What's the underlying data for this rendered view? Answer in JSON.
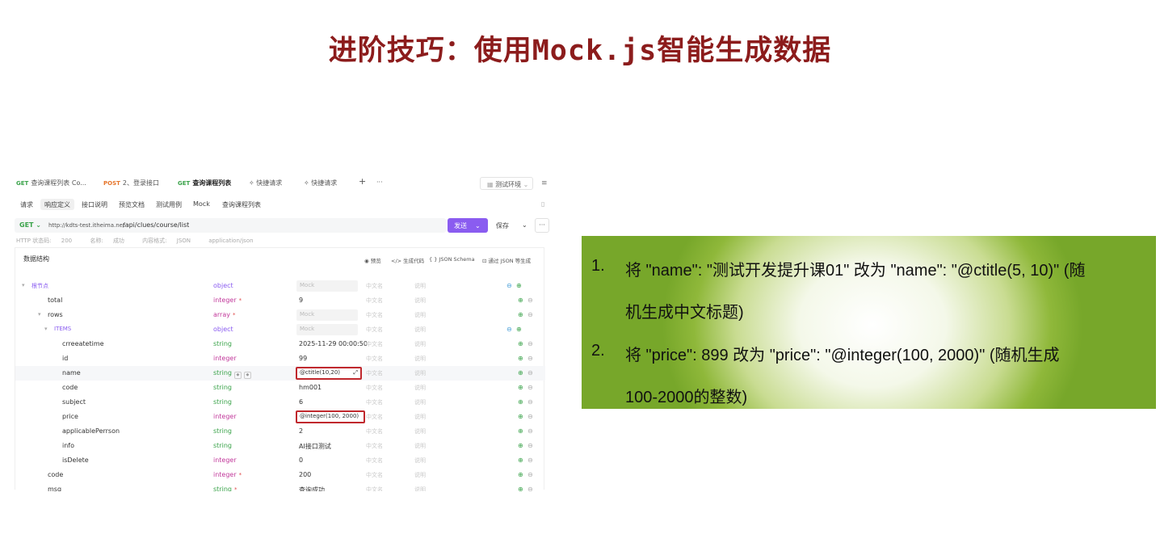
{
  "slide_title": "进阶技巧：使用Mock.js智能生成数据",
  "tabs": [
    {
      "method": "GET",
      "label": "查询课程列表 Co..."
    },
    {
      "method": "POST",
      "label": "2、登录接口"
    },
    {
      "method": "GET",
      "label": "查询课程列表"
    },
    {
      "method": "",
      "label": "快捷请求"
    },
    {
      "method": "",
      "label": "快捷请求"
    }
  ],
  "tab_add": "+",
  "tab_more": "···",
  "environment": "测试环境",
  "menu_icon": "≡",
  "sub_tabs": [
    "请求",
    "响应定义",
    "接口说明",
    "预览文档",
    "测试用例",
    "Mock",
    "查询课程列表"
  ],
  "sub_right_icon": "▯",
  "url": {
    "method": "GET",
    "base": "http://kdts-test.itheima.net",
    "path": "/api/clues/course/list",
    "send": "发送",
    "save": "保存",
    "chevron": "⌄",
    "more": "···"
  },
  "status": {
    "http_label": "HTTP 状态码:",
    "http_value": "200",
    "name_label": "名称:",
    "name_value": "成功",
    "format_label": "内容格式:",
    "format_value": "JSON",
    "content_type": "application/json"
  },
  "panel": {
    "title": "数据结构",
    "tools": [
      "◉ 预览",
      "</> 生成代码",
      "{ } JSON Schema",
      "⊡ 通过 JSON 等生成"
    ]
  },
  "schema_rows": [
    {
      "field": "根节点",
      "type": "object",
      "mock": "",
      "mock_ph": "Mock",
      "level": 0,
      "kind": "root",
      "expand": "▾",
      "req": false,
      "chips": false,
      "actions": [
        "⊖",
        "⊕"
      ],
      "box": false,
      "hl": false
    },
    {
      "field": "total",
      "type": "integer",
      "mock": "9",
      "mock_ph": "",
      "level": 1,
      "kind": "",
      "expand": "",
      "req": true,
      "chips": false,
      "actions": [
        "⊕",
        "⊖"
      ],
      "box": false,
      "hl": false
    },
    {
      "field": "rows",
      "type": "array",
      "mock": "",
      "mock_ph": "Mock",
      "level": 1,
      "kind": "",
      "expand": "▾",
      "req": true,
      "chips": false,
      "actions": [
        "⊕",
        "⊖"
      ],
      "box": false,
      "hl": false
    },
    {
      "field": "ITEMS",
      "type": "object",
      "mock": "",
      "mock_ph": "Mock",
      "level": 2,
      "kind": "items",
      "expand": "▾",
      "req": false,
      "chips": false,
      "actions": [
        "⊖",
        "⊕"
      ],
      "box": false,
      "hl": false
    },
    {
      "field": "crreeatetime",
      "type": "string",
      "mock": "2025-11-29 00:00:50",
      "mock_ph": "",
      "level": 3,
      "kind": "",
      "expand": "",
      "req": false,
      "chips": false,
      "actions": [
        "⊕",
        "⊖"
      ],
      "box": false,
      "hl": false
    },
    {
      "field": "id",
      "type": "integer",
      "mock": "99",
      "mock_ph": "",
      "level": 3,
      "kind": "",
      "expand": "",
      "req": false,
      "chips": false,
      "actions": [
        "⊕",
        "⊖"
      ],
      "box": false,
      "hl": false
    },
    {
      "field": "name",
      "type": "string",
      "mock": "@ctitle(10,20)",
      "mock_ph": "",
      "level": 3,
      "kind": "",
      "expand": "",
      "req": false,
      "chips": true,
      "actions": [
        "⊕",
        "⊖"
      ],
      "box": true,
      "hl": true
    },
    {
      "field": "code",
      "type": "string",
      "mock": "hm001",
      "mock_ph": "",
      "level": 3,
      "kind": "",
      "expand": "",
      "req": false,
      "chips": false,
      "actions": [
        "⊕",
        "⊖"
      ],
      "box": false,
      "hl": false
    },
    {
      "field": "subject",
      "type": "string",
      "mock": "6",
      "mock_ph": "",
      "level": 3,
      "kind": "",
      "expand": "",
      "req": false,
      "chips": false,
      "actions": [
        "⊕",
        "⊖"
      ],
      "box": false,
      "hl": false
    },
    {
      "field": "price",
      "type": "integer",
      "mock": "@integer(100, 2000)",
      "mock_ph": "",
      "level": 3,
      "kind": "",
      "expand": "",
      "req": false,
      "chips": false,
      "actions": [
        "⊕",
        "⊖"
      ],
      "box": true,
      "hl": false
    },
    {
      "field": "applicablePerrson",
      "type": "string",
      "mock": "2",
      "mock_ph": "",
      "level": 3,
      "kind": "",
      "expand": "",
      "req": false,
      "chips": false,
      "actions": [
        "⊕",
        "⊖"
      ],
      "box": false,
      "hl": false
    },
    {
      "field": "info",
      "type": "string",
      "mock": "AI接口测试",
      "mock_ph": "",
      "level": 3,
      "kind": "",
      "expand": "",
      "req": false,
      "chips": false,
      "actions": [
        "⊕",
        "⊖"
      ],
      "box": false,
      "hl": false
    },
    {
      "field": "isDelete",
      "type": "integer",
      "mock": "0",
      "mock_ph": "",
      "level": 3,
      "kind": "",
      "expand": "",
      "req": false,
      "chips": false,
      "actions": [
        "⊕",
        "⊖"
      ],
      "box": false,
      "hl": false
    },
    {
      "field": "code",
      "type": "integer",
      "mock": "200",
      "mock_ph": "",
      "level": 1,
      "kind": "",
      "expand": "",
      "req": true,
      "chips": false,
      "actions": [
        "⊕",
        "⊖"
      ],
      "box": false,
      "hl": false
    },
    {
      "field": "msg",
      "type": "string",
      "mock": "查询成功",
      "mock_ph": "",
      "level": 1,
      "kind": "",
      "expand": "",
      "req": true,
      "chips": false,
      "actions": [
        "⊕",
        "⊖"
      ],
      "box": false,
      "hl": false
    }
  ],
  "col_placeholders": {
    "cn_name": "中文名",
    "desc": "说明"
  },
  "markers": {
    "required": "*",
    "chip_a": "◆",
    "chip_b": "◆",
    "expand_icon": "⤢"
  },
  "instructions": [
    {
      "num": "1.",
      "lines": [
        "将 \"name\": \"测试开发提升课01\" 改为 \"name\": \"@ctitle(5, 10)\" (随",
        "机生成中文标题)"
      ]
    },
    {
      "num": "2.",
      "lines": [
        "将 \"price\": 899 改为 \"price\": \"@integer(100, 2000)\" (随机生成",
        "100-2000的整数)"
      ]
    }
  ]
}
